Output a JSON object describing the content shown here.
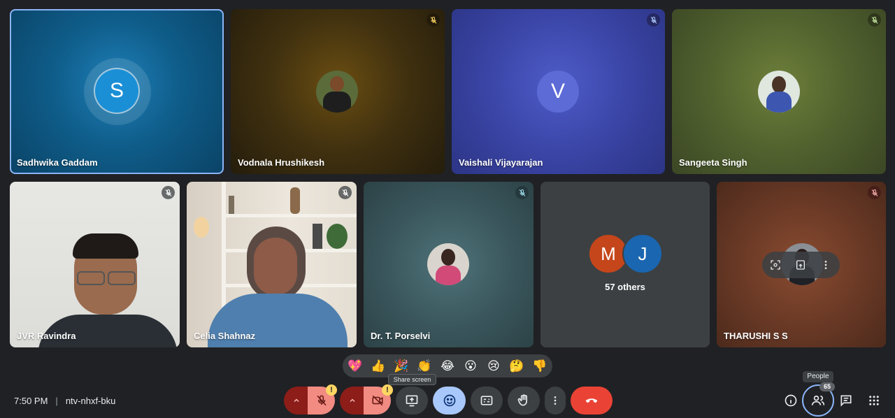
{
  "participants": [
    {
      "name": "Sadhwika Gaddam",
      "initial": "S",
      "muted": false
    },
    {
      "name": "Vodnala Hrushikesh",
      "muted": true
    },
    {
      "name": "Vaishali Vijayarajan",
      "initial": "V",
      "muted": true
    },
    {
      "name": "Sangeeta Singh",
      "muted": true
    },
    {
      "name": "JVR Ravindra",
      "muted": true
    },
    {
      "name": "Celia Shahnaz",
      "muted": true
    },
    {
      "name": "Dr. T. Porselvi",
      "muted": true
    },
    {
      "name": "THARUSHI S S",
      "muted": true
    }
  ],
  "others_tile": {
    "initials": [
      "M",
      "J"
    ],
    "label": "57 others"
  },
  "reactions": [
    "💖",
    "👍",
    "🎉",
    "👏",
    "😂",
    "😮",
    "😢",
    "🤔",
    "👎"
  ],
  "meeting": {
    "time": "7:50 PM",
    "separator": "|",
    "code": "ntv-nhxf-bku"
  },
  "controls": {
    "share_tooltip": "Share screen",
    "mic_badge": "!",
    "cam_badge": "!"
  },
  "people": {
    "tooltip": "People",
    "count": "65"
  },
  "colors": {
    "accent": "#8ab4f8",
    "end_call": "#ea4335",
    "muted_control": "#f28b82",
    "emoji_active": "#a8c7fa"
  }
}
